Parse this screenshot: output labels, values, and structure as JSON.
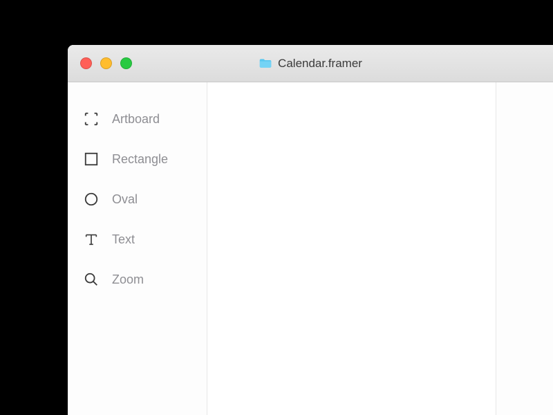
{
  "titlebar": {
    "document_name": "Calendar.framer"
  },
  "sidebar": {
    "tools": [
      {
        "id": "artboard",
        "label": "Artboard"
      },
      {
        "id": "rectangle",
        "label": "Rectangle"
      },
      {
        "id": "oval",
        "label": "Oval"
      },
      {
        "id": "text",
        "label": "Text"
      },
      {
        "id": "zoom",
        "label": "Zoom"
      }
    ]
  },
  "colors": {
    "traffic_close": "#ff5f57",
    "traffic_minimize": "#ffbd2e",
    "traffic_maximize": "#28ca42",
    "folder_icon": "#58c7f0",
    "label_gray": "#8e8e93"
  }
}
